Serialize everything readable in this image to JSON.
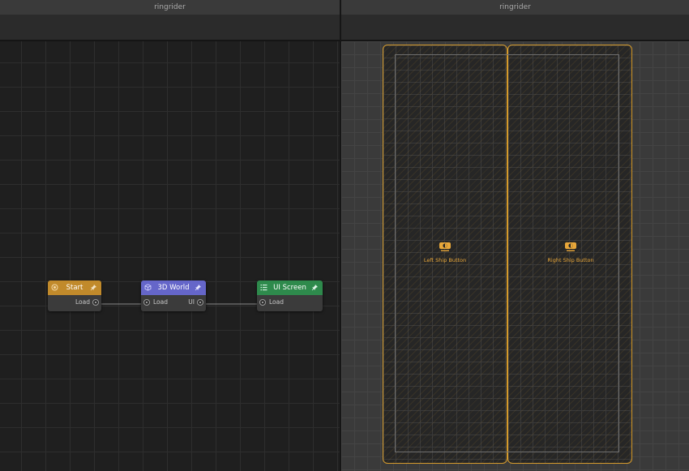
{
  "left_window": {
    "title": "ringrider"
  },
  "right_window": {
    "title": "ringrider"
  },
  "graph": {
    "nodes": [
      {
        "title": "Start",
        "color": "#c18a2b",
        "outputs": [
          "Load"
        ],
        "inputs": []
      },
      {
        "title": "3D World",
        "color": "#6566c9",
        "inputs": [
          "Load"
        ],
        "outputs": [
          "UI"
        ]
      },
      {
        "title": "UI Screen",
        "color": "#2e8a4c",
        "inputs": [
          "Load"
        ],
        "outputs": []
      }
    ]
  },
  "scene": {
    "accent": "#d49a2c",
    "elements": [
      {
        "label": "Left Ship Button",
        "icon": "ship-button-icon"
      },
      {
        "label": "Right Ship Button",
        "icon": "ship-button-icon"
      }
    ]
  }
}
